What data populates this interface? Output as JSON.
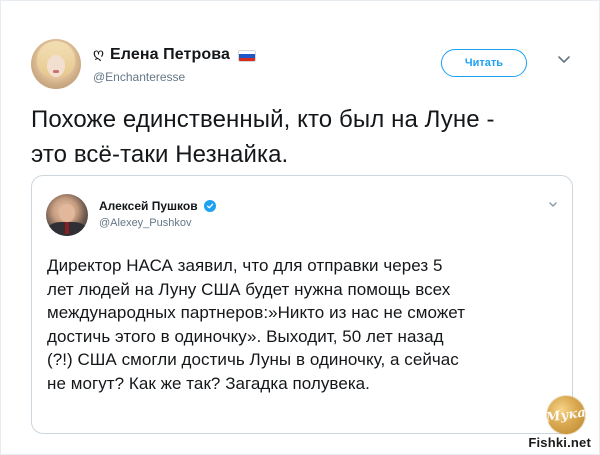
{
  "tweet": {
    "author": {
      "symbol": "ღ",
      "display_name": "Елена Петрова",
      "flag": "russia-flag",
      "handle": "@Enchanteresse"
    },
    "follow_label": "Читать",
    "text": "Похоже единственный, кто был на Луне -\nэто всё-таки Незнайка."
  },
  "quoted": {
    "author": {
      "display_name": "Алексей Пушков",
      "verified": true,
      "handle": "@Alexey_Pushkov"
    },
    "text": "Директор НАСА заявил, что для отправки через 5\nлет людей на Луну США будет нужна помощь всех\nмеждународных партнеров:»Никто из нас не сможет\nдостичь этого в одиночку». Выходит, 50 лет назад\n(?!) США смогли достичь Луны в одиночку, а сейчас\nне могут? Как же так? Загадка полувека."
  },
  "watermarks": {
    "logo_text": "Мука",
    "site": "Fishki.net"
  },
  "colors": {
    "accent": "#1da1f2",
    "text": "#14171a",
    "muted": "#657786",
    "border": "#ccd6dd"
  }
}
